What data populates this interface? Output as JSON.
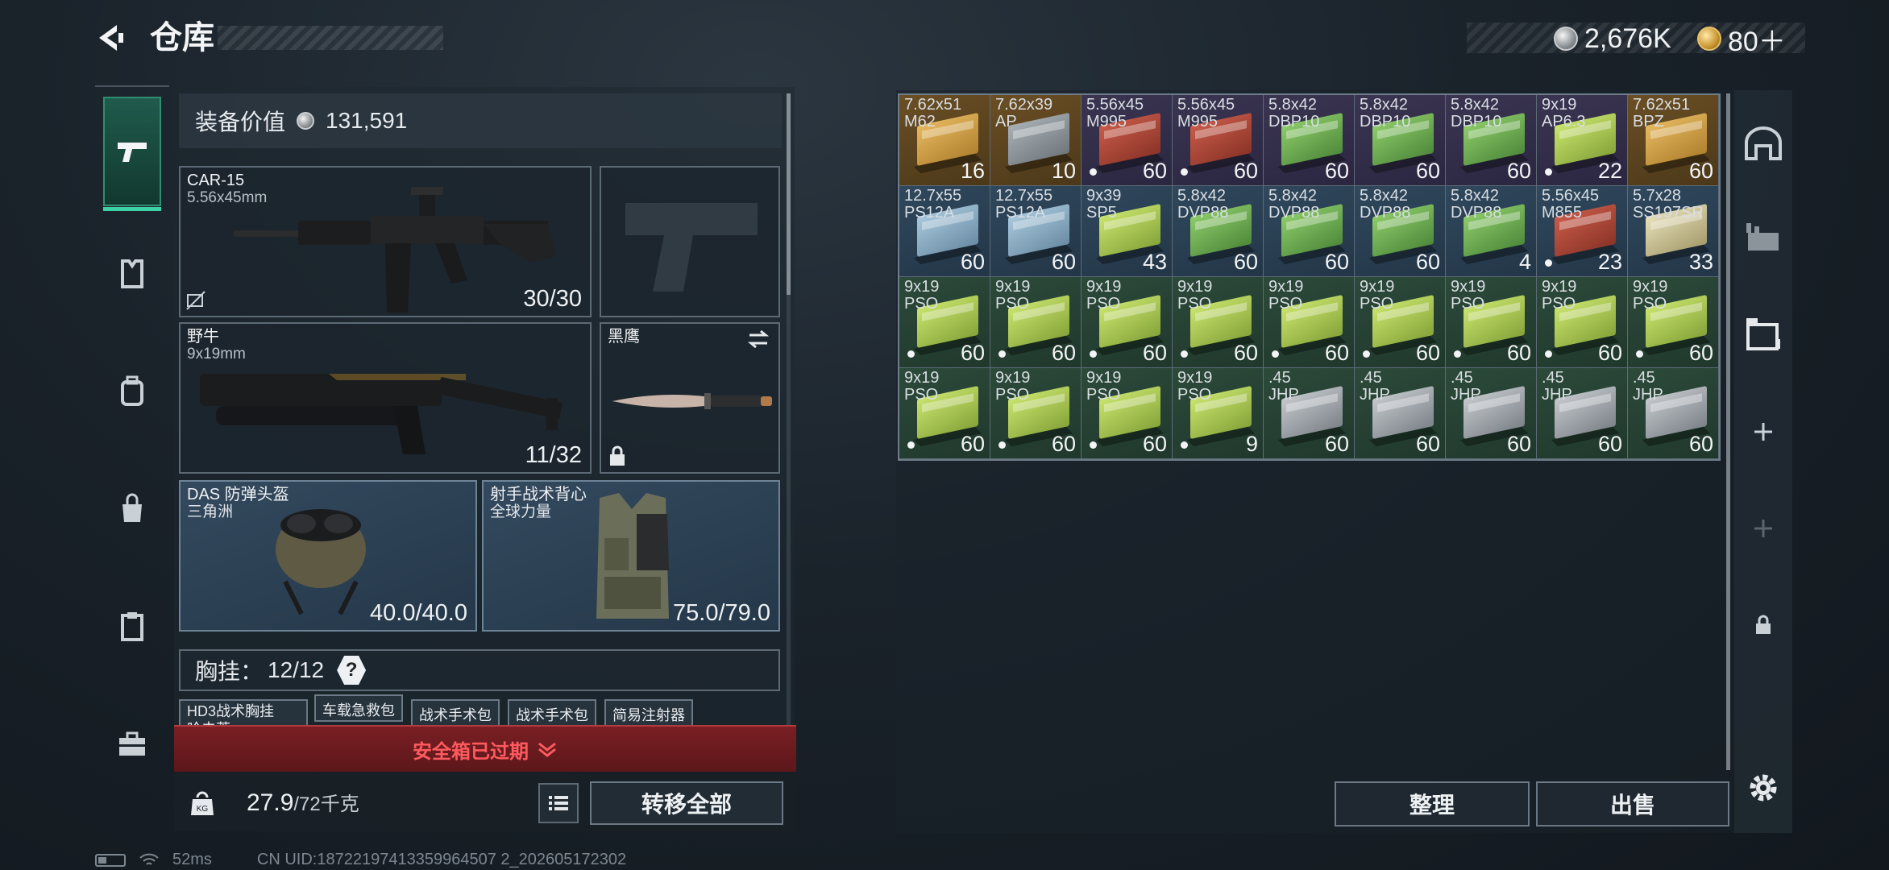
{
  "header": {
    "title": "仓库",
    "currency_silver": "2,676K",
    "currency_gold": "80＋"
  },
  "equipment": {
    "value_label": "装备价值",
    "value": "131,591",
    "primary": {
      "name": "CAR-15",
      "caliber": "5.56x45mm",
      "ammo": "30/30"
    },
    "secondary": {
      "name": "野牛",
      "caliber": "9x19mm",
      "ammo": "11/32"
    },
    "melee": {
      "name": "黑鹰"
    },
    "helmet": {
      "name": "DAS 防弹头盔",
      "brand": "三角洲",
      "durability": "40.0/40.0"
    },
    "vest": {
      "name": "射手战术背心",
      "brand": "全球力量",
      "durability": "75.0/79.0"
    },
    "chest_rig": {
      "label": "胸挂：",
      "capacity": "12/12",
      "help": "?"
    },
    "rig_items": [
      "HD3战术胸挂",
      "车载急救包",
      "战术手术包",
      "战术手术包",
      "简易注射器"
    ],
    "rig_item_sub": "哈夫莱"
  },
  "warning": {
    "text": "安全箱已过期"
  },
  "footer": {
    "weight": "27.9",
    "weight_max": "/72千克",
    "transfer_all": "转移全部",
    "organize": "整理",
    "sell": "出售"
  },
  "inventory": [
    {
      "cal1": "7.62x51",
      "cal2": "M62",
      "count": "16",
      "dot": false,
      "bg": "gold",
      "box": "gold"
    },
    {
      "cal1": "7.62x39",
      "cal2": "AP",
      "count": "10",
      "dot": false,
      "bg": "gold",
      "box": "grey"
    },
    {
      "cal1": "5.56x45",
      "cal2": "M995",
      "count": "60",
      "dot": true,
      "bg": "purple",
      "box": "red"
    },
    {
      "cal1": "5.56x45",
      "cal2": "M995",
      "count": "60",
      "dot": true,
      "bg": "purple",
      "box": "red"
    },
    {
      "cal1": "5.8x42",
      "cal2": "DBP10",
      "count": "60",
      "dot": false,
      "bg": "purple",
      "box": "green"
    },
    {
      "cal1": "5.8x42",
      "cal2": "DBP10",
      "count": "60",
      "dot": false,
      "bg": "purple",
      "box": "green"
    },
    {
      "cal1": "5.8x42",
      "cal2": "DBP10",
      "count": "60",
      "dot": false,
      "bg": "purple",
      "box": "green"
    },
    {
      "cal1": "9x19",
      "cal2": "AP6.3",
      "count": "22",
      "dot": true,
      "bg": "purple",
      "box": "lime"
    },
    {
      "cal1": "7.62x51",
      "cal2": "BPZ",
      "count": "60",
      "dot": false,
      "bg": "gold",
      "box": "gold"
    },
    {
      "cal1": "12.7x55",
      "cal2": "PS12A",
      "count": "60",
      "dot": false,
      "bg": "blue",
      "box": "lightblue"
    },
    {
      "cal1": "12.7x55",
      "cal2": "PS12A",
      "count": "60",
      "dot": false,
      "bg": "blue",
      "box": "lightblue"
    },
    {
      "cal1": "9x39",
      "cal2": "SP5",
      "count": "43",
      "dot": false,
      "bg": "blue",
      "box": "lime"
    },
    {
      "cal1": "5.8x42",
      "cal2": "DVP88",
      "count": "60",
      "dot": false,
      "bg": "blue",
      "box": "green"
    },
    {
      "cal1": "5.8x42",
      "cal2": "DVP88",
      "count": "60",
      "dot": false,
      "bg": "blue",
      "box": "green"
    },
    {
      "cal1": "5.8x42",
      "cal2": "DVP88",
      "count": "60",
      "dot": false,
      "bg": "blue",
      "box": "green"
    },
    {
      "cal1": "5.8x42",
      "cal2": "DVP88",
      "count": "4",
      "dot": false,
      "bg": "blue",
      "box": "green"
    },
    {
      "cal1": "5.56x45",
      "cal2": "M855",
      "count": "23",
      "dot": true,
      "bg": "blue",
      "box": "red"
    },
    {
      "cal1": "5.7x28",
      "cal2": "SS197SR",
      "count": "33",
      "dot": false,
      "bg": "blue",
      "box": "cream"
    },
    {
      "cal1": "9x19",
      "cal2": "PSO",
      "count": "60",
      "dot": true,
      "bg": "green",
      "box": "lime"
    },
    {
      "cal1": "9x19",
      "cal2": "PSO",
      "count": "60",
      "dot": true,
      "bg": "green",
      "box": "lime"
    },
    {
      "cal1": "9x19",
      "cal2": "PSO",
      "count": "60",
      "dot": true,
      "bg": "green",
      "box": "lime"
    },
    {
      "cal1": "9x19",
      "cal2": "PSO",
      "count": "60",
      "dot": true,
      "bg": "green",
      "box": "lime"
    },
    {
      "cal1": "9x19",
      "cal2": "PSO",
      "count": "60",
      "dot": true,
      "bg": "green",
      "box": "lime"
    },
    {
      "cal1": "9x19",
      "cal2": "PSO",
      "count": "60",
      "dot": true,
      "bg": "green",
      "box": "lime"
    },
    {
      "cal1": "9x19",
      "cal2": "PSO",
      "count": "60",
      "dot": true,
      "bg": "green",
      "box": "lime"
    },
    {
      "cal1": "9x19",
      "cal2": "PSO",
      "count": "60",
      "dot": true,
      "bg": "green",
      "box": "lime"
    },
    {
      "cal1": "9x19",
      "cal2": "PSO",
      "count": "60",
      "dot": true,
      "bg": "green",
      "box": "lime"
    },
    {
      "cal1": "9x19",
      "cal2": "PSO",
      "count": "60",
      "dot": true,
      "bg": "green",
      "box": "lime"
    },
    {
      "cal1": "9x19",
      "cal2": "PSO",
      "count": "60",
      "dot": true,
      "bg": "green",
      "box": "lime"
    },
    {
      "cal1": "9x19",
      "cal2": "PSO",
      "count": "60",
      "dot": true,
      "bg": "green",
      "box": "lime"
    },
    {
      "cal1": "9x19",
      "cal2": "PSO",
      "count": "9",
      "dot": true,
      "bg": "green",
      "box": "lime"
    },
    {
      "cal1": ".45",
      "cal2": "JHP",
      "count": "60",
      "dot": false,
      "bg": "green",
      "box": "silver"
    },
    {
      "cal1": ".45",
      "cal2": "JHP",
      "count": "60",
      "dot": false,
      "bg": "green",
      "box": "silver"
    },
    {
      "cal1": ".45",
      "cal2": "JHP",
      "count": "60",
      "dot": false,
      "bg": "green",
      "box": "silver"
    },
    {
      "cal1": ".45",
      "cal2": "JHP",
      "count": "60",
      "dot": false,
      "bg": "green",
      "box": "silver"
    },
    {
      "cal1": ".45",
      "cal2": "JHP",
      "count": "60",
      "dot": false,
      "bg": "green",
      "box": "silver"
    }
  ],
  "status": {
    "ping": "52ms",
    "uid": "CN UID:18722197413359964507 2_202605172302"
  }
}
